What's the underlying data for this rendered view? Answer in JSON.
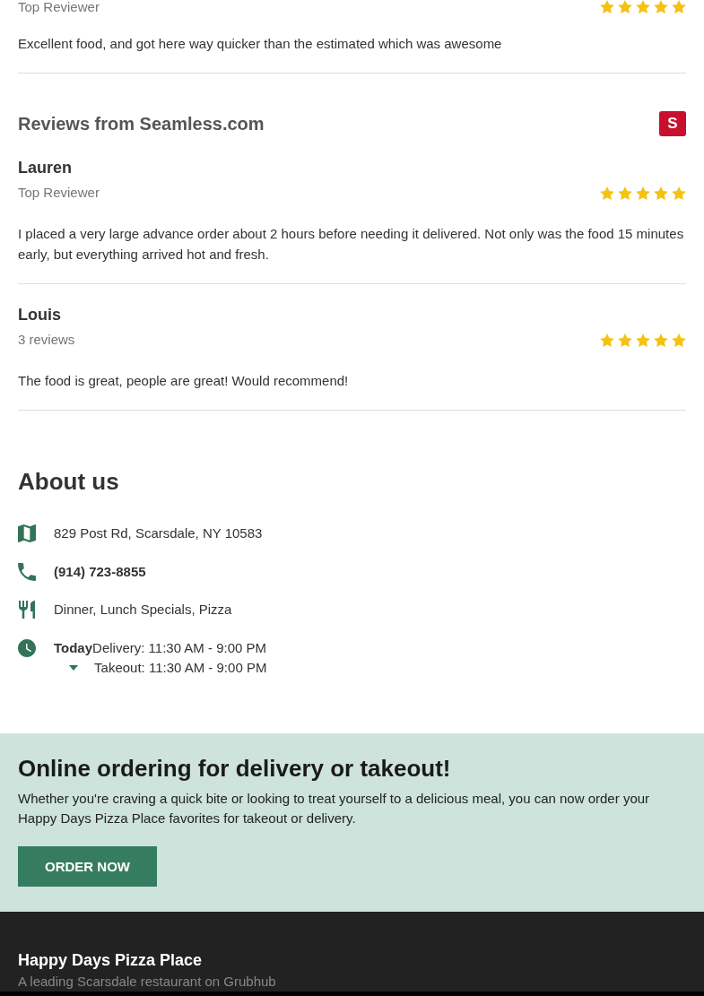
{
  "previous_review": {
    "subtitle": "Top Reviewer",
    "stars": 5,
    "text": "Excellent food, and got here way quicker than the estimated which was awesome"
  },
  "seamless_reviews": {
    "title": "Reviews from Seamless.com",
    "logo_letter": "S",
    "reviews": [
      {
        "name": "Lauren",
        "subtitle": "Top Reviewer",
        "stars": 5,
        "text": "I placed a very large advance order about 2 hours before needing it delivered. Not only was the food 15 minutes early, but everything arrived hot and fresh."
      },
      {
        "name": "Louis",
        "subtitle": "3 reviews",
        "stars": 5,
        "text": "The food is great, people are great! Would recommend!"
      }
    ]
  },
  "about": {
    "title": "About us",
    "items": [
      {
        "kind": "address",
        "text": "829 Post Rd, Scarsdale, NY 10583"
      },
      {
        "kind": "phone",
        "text": "(914) 723-8855"
      },
      {
        "kind": "cuisine",
        "text": "Dinner, Lunch Specials, Pizza"
      },
      {
        "kind": "hours",
        "day": "Today",
        "lines": [
          "Delivery: 11:30 AM - 9:00 PM",
          "Takeout: 11:30 AM - 9:00 PM"
        ]
      }
    ]
  },
  "order_banner": {
    "title": "Online ordering for delivery or takeout!",
    "text": "Whether you're craving a quick bite or looking to treat yourself to a delicious meal, you can now order your Happy Days Pizza Place favorites for takeout or delivery.",
    "button": "ORDER NOW"
  },
  "footer": {
    "title": "Happy Days Pizza Place",
    "subtitle": "A leading Scarsdale restaurant on Grubhub"
  }
}
